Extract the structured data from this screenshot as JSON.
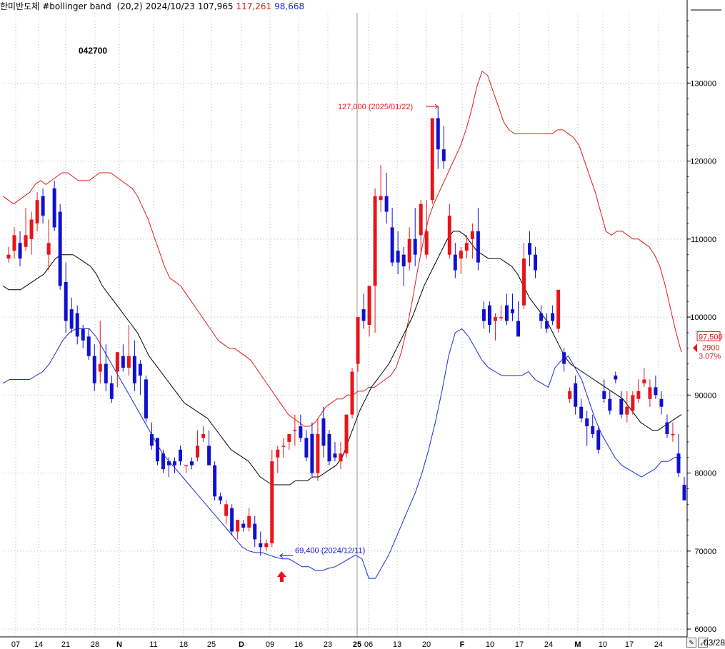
{
  "header": {
    "name": "한미반도체",
    "indicator": "#bollinger band",
    "params": "(20,2)",
    "date": "2024/10/23",
    "middle": "107,965",
    "upper": "117,261",
    "lower": "98,668"
  },
  "code": "042700",
  "colors": {
    "up": "#e8141a",
    "down": "#1010d0",
    "upper_band": "#e01818",
    "lower_band": "#1d2ad8",
    "middle_band": "#000000",
    "grid": "#b8b8b8"
  },
  "end_date": "03/28",
  "toolbar_icons": [
    "pencil-icon",
    "resize-icon"
  ],
  "chart_data": {
    "type": "candlestick",
    "x_ticks": [
      "07",
      "14",
      "21",
      "28",
      "N",
      "11",
      "18",
      "25",
      "D",
      "09",
      "16",
      "23",
      "25",
      "06",
      "13",
      "20",
      "F",
      "10",
      "17",
      "24",
      "M",
      "10",
      "17",
      "24"
    ],
    "ylim": [
      59000,
      139000
    ],
    "y_ticks": [
      60000,
      70000,
      80000,
      90000,
      100000,
      110000,
      120000,
      130000
    ],
    "annotations": [
      {
        "text": "127,000 (2025/01/22)",
        "value": 127000,
        "kind": "high"
      },
      {
        "text": "69,400 (2024/12/11)",
        "value": 69400,
        "kind": "low"
      }
    ],
    "last_price": {
      "price": "97,500",
      "change": "2900",
      "change_pct": "3.07%"
    },
    "series": [
      {
        "name": "candles",
        "values": [
          [
            107500,
            109000,
            107000,
            108000
          ],
          [
            108500,
            111500,
            107500,
            110500
          ],
          [
            109500,
            111000,
            106500,
            107500
          ],
          [
            109000,
            114000,
            108500,
            110500
          ],
          [
            110000,
            113500,
            108000,
            112500
          ],
          [
            112000,
            116000,
            111000,
            115000
          ],
          [
            115500,
            116500,
            112000,
            113000
          ],
          [
            108000,
            112500,
            106000,
            109500
          ],
          [
            116500,
            117500,
            111000,
            111500
          ],
          [
            113500,
            114500,
            103500,
            104000
          ],
          [
            104500,
            107000,
            98000,
            99500
          ],
          [
            101000,
            102500,
            98000,
            98500
          ],
          [
            100500,
            101500,
            96500,
            97500
          ],
          [
            98500,
            99000,
            96000,
            97000
          ],
          [
            97500,
            98500,
            94500,
            95000
          ],
          [
            95000,
            96500,
            90500,
            91500
          ],
          [
            93000,
            99500,
            91500,
            94000
          ],
          [
            94000,
            96500,
            90500,
            91500
          ],
          [
            91500,
            92500,
            89000,
            89500
          ],
          [
            93000,
            95500,
            91000,
            95500
          ],
          [
            95000,
            96500,
            93000,
            93500
          ],
          [
            93500,
            99000,
            92500,
            95000
          ],
          [
            95000,
            97000,
            90500,
            91500
          ],
          [
            94000,
            94500,
            90000,
            92500
          ],
          [
            92000,
            92500,
            86500,
            87000
          ],
          [
            85000,
            86500,
            83000,
            83500
          ],
          [
            84500,
            84500,
            81000,
            81500
          ],
          [
            82500,
            83000,
            80000,
            80500
          ],
          [
            81500,
            82000,
            79500,
            81000
          ],
          [
            81500,
            82000,
            80000,
            81000
          ],
          [
            83000,
            83500,
            81000,
            81500
          ],
          [
            81000,
            81000,
            80000,
            81000
          ],
          [
            81500,
            82000,
            80500,
            81000
          ],
          [
            82000,
            85500,
            81500,
            83500
          ],
          [
            84500,
            86000,
            84000,
            85000
          ],
          [
            83500,
            85500,
            81000,
            81000
          ],
          [
            81000,
            81500,
            76500,
            77000
          ],
          [
            77000,
            77500,
            76000,
            76500
          ],
          [
            74500,
            76500,
            73500,
            76000
          ],
          [
            75500,
            76000,
            72000,
            72500
          ],
          [
            72500,
            74000,
            71500,
            74000
          ],
          [
            73500,
            74000,
            72500,
            73000
          ],
          [
            73000,
            75500,
            72500,
            74500
          ],
          [
            73500,
            74500,
            70500,
            71500
          ],
          [
            71000,
            72500,
            69400,
            70500
          ],
          [
            70500,
            71500,
            70000,
            71000
          ],
          [
            71000,
            83000,
            70500,
            81500
          ],
          [
            82000,
            83500,
            80000,
            83000
          ],
          [
            83500,
            84500,
            82000,
            83500
          ],
          [
            84000,
            85000,
            83000,
            85000
          ],
          [
            85500,
            87500,
            83500,
            85500
          ],
          [
            86000,
            87500,
            84000,
            84500
          ],
          [
            84500,
            85500,
            81500,
            82000
          ],
          [
            85000,
            86500,
            79500,
            80000
          ],
          [
            80000,
            87000,
            79000,
            85000
          ],
          [
            87000,
            88500,
            82000,
            83500
          ],
          [
            85000,
            85500,
            81000,
            81500
          ],
          [
            82500,
            84000,
            81500,
            82000
          ],
          [
            81500,
            84000,
            80500,
            82500
          ],
          [
            82500,
            87500,
            82000,
            87500
          ],
          [
            87500,
            93500,
            87000,
            93000
          ],
          [
            94000,
            99500,
            93000,
            100000
          ],
          [
            101000,
            103000,
            98500,
            99500
          ],
          [
            99000,
            104000,
            97500,
            104000
          ],
          [
            104000,
            116500,
            98000,
            115500
          ],
          [
            115000,
            119500,
            113500,
            115500
          ],
          [
            115500,
            118500,
            112000,
            113500
          ],
          [
            111500,
            114000,
            106500,
            107000
          ],
          [
            108500,
            111000,
            105500,
            107000
          ],
          [
            108000,
            109000,
            104000,
            106500
          ],
          [
            107000,
            111500,
            106000,
            110000
          ],
          [
            110000,
            114000,
            106500,
            108000
          ],
          [
            110500,
            115000,
            108000,
            114500
          ],
          [
            108000,
            115000,
            107500,
            111000
          ],
          [
            115000,
            121500,
            114500,
            125500
          ],
          [
            125500,
            127000,
            119000,
            121500
          ],
          [
            121500,
            124500,
            119000,
            120000
          ],
          [
            108000,
            114500,
            107500,
            113000
          ],
          [
            108000,
            109500,
            105000,
            106000
          ],
          [
            107500,
            109000,
            105500,
            108500
          ],
          [
            108500,
            110500,
            107500,
            109500
          ],
          [
            110000,
            112000,
            107500,
            111000
          ],
          [
            111000,
            114000,
            106000,
            107000
          ],
          [
            101000,
            102000,
            98500,
            99500
          ],
          [
            101500,
            102000,
            98000,
            99000
          ],
          [
            99500,
            100500,
            97000,
            100000
          ],
          [
            100000,
            101500,
            99500,
            100000
          ],
          [
            101500,
            103000,
            99000,
            99500
          ],
          [
            101000,
            103000,
            99500,
            100500
          ],
          [
            99500,
            102000,
            97500,
            97500
          ],
          [
            101500,
            109500,
            101000,
            107500
          ],
          [
            109500,
            111000,
            106500,
            108000
          ],
          [
            108000,
            109000,
            105000,
            106000
          ],
          [
            100500,
            101500,
            98500,
            99500
          ],
          [
            99500,
            100500,
            98000,
            98500
          ],
          [
            100500,
            101500,
            99000,
            99500
          ],
          [
            98500,
            103500,
            98000,
            103500
          ],
          [
            95500,
            96000,
            93000,
            94000
          ],
          [
            89500,
            91000,
            89000,
            90500
          ],
          [
            91500,
            92500,
            87500,
            88500
          ],
          [
            88500,
            89500,
            86500,
            87000
          ],
          [
            87000,
            88000,
            83500,
            86000
          ],
          [
            86000,
            87500,
            84500,
            85000
          ],
          [
            85500,
            86000,
            82500,
            83000
          ],
          [
            90500,
            92000,
            89000,
            89500
          ],
          [
            89500,
            90500,
            87500,
            88000
          ],
          [
            92500,
            93000,
            91500,
            92000
          ],
          [
            89500,
            90500,
            87000,
            87500
          ],
          [
            87500,
            90500,
            86500,
            88500
          ],
          [
            88000,
            90500,
            87500,
            90000
          ],
          [
            89500,
            92000,
            89000,
            90500
          ],
          [
            91500,
            93500,
            91000,
            92000
          ],
          [
            89500,
            92000,
            88500,
            91000
          ],
          [
            91000,
            92500,
            89500,
            90000
          ],
          [
            89500,
            90500,
            87500,
            88500
          ],
          [
            86500,
            87500,
            84500,
            85000
          ],
          [
            85000,
            86500,
            84000,
            85000
          ],
          [
            82500,
            85000,
            79500,
            80000
          ],
          [
            78500,
            79500,
            76500,
            76500
          ]
        ]
      },
      {
        "name": "upper_band",
        "values": [
          115500,
          115000,
          114500,
          115000,
          115500,
          116000,
          117000,
          117500,
          117000,
          117500,
          118000,
          118500,
          118500,
          118000,
          117500,
          117500,
          117500,
          118000,
          118500,
          118500,
          118500,
          118000,
          117500,
          117000,
          116500,
          115500,
          114000,
          112500,
          110500,
          108500,
          106500,
          105000,
          104500,
          104000,
          103000,
          102000,
          101000,
          100000,
          99000,
          98000,
          97000,
          96500,
          96000,
          96000,
          95500,
          95000,
          94500,
          93500,
          92500,
          91500,
          90500,
          89500,
          88500,
          87500,
          87000,
          86500,
          86000,
          86000,
          86500,
          87500,
          88500,
          89000,
          89500,
          89500,
          90000,
          90000,
          90500,
          90500,
          91000,
          91000,
          91500,
          92000,
          92500,
          93500,
          95500,
          98500,
          102000,
          106000,
          109500,
          112500,
          114500,
          116000,
          117500,
          119000,
          120500,
          122000,
          124000,
          126500,
          129500,
          131500,
          131000,
          129000,
          127000,
          125000,
          124000,
          123500,
          123500,
          123500,
          123500,
          123500,
          123500,
          123500,
          123500,
          124000,
          124000,
          123500,
          123000,
          122000,
          120000,
          118000,
          116000,
          113500,
          111000,
          110500,
          111000,
          111000,
          110500,
          110000,
          110000,
          109500,
          109000,
          108000,
          106500,
          104000,
          101000,
          98000,
          95500
        ]
      },
      {
        "name": "middle_band",
        "values": [
          104000,
          103500,
          103500,
          103500,
          104000,
          104500,
          105000,
          105500,
          106500,
          107500,
          108000,
          108000,
          108000,
          107500,
          107000,
          106500,
          105500,
          104000,
          103000,
          102000,
          101000,
          100000,
          99000,
          98000,
          96500,
          95000,
          94000,
          93000,
          92000,
          91000,
          90000,
          89000,
          88500,
          88000,
          87500,
          87000,
          86000,
          85000,
          84000,
          83000,
          82500,
          82000,
          81500,
          80500,
          79500,
          79000,
          78500,
          78500,
          78500,
          78500,
          79000,
          79000,
          79000,
          79500,
          79500,
          80000,
          80500,
          81000,
          82000,
          84000,
          86000,
          88000,
          89500,
          91000,
          92000,
          93000,
          94000,
          95500,
          97000,
          98500,
          100000,
          102000,
          104000,
          105500,
          107000,
          108500,
          110000,
          111000,
          111000,
          110500,
          109500,
          108500,
          108000,
          107500,
          107500,
          107500,
          107000,
          106500,
          105500,
          104000,
          102500,
          101500,
          100500,
          99500,
          98000,
          96500,
          95000,
          94000,
          93500,
          93000,
          92500,
          92000,
          91500,
          91000,
          90500,
          90000,
          89500,
          88500,
          87500,
          86500,
          86000,
          85500,
          85500,
          86000,
          86500,
          87000,
          87500
        ]
      },
      {
        "name": "lower_band",
        "values": [
          91500,
          92000,
          92000,
          92000,
          92000,
          92500,
          93000,
          94000,
          95500,
          97000,
          98000,
          98500,
          98500,
          98500,
          97500,
          96000,
          94500,
          93000,
          91500,
          90000,
          88500,
          87000,
          85500,
          84000,
          82500,
          81500,
          80500,
          79500,
          78500,
          77500,
          76500,
          75500,
          74500,
          73500,
          72500,
          71500,
          70500,
          70000,
          69800,
          69800,
          69500,
          69200,
          69000,
          69000,
          68500,
          68000,
          68000,
          67500,
          67500,
          67800,
          68000,
          68500,
          69000,
          69500,
          69000,
          66500,
          66500,
          68000,
          69500,
          71500,
          73500,
          75500,
          77500,
          80000,
          83000,
          86500,
          90500,
          95000,
          98000,
          98500,
          97500,
          96000,
          94500,
          93500,
          93000,
          92500,
          92500,
          92500,
          92500,
          93000,
          92000,
          91500,
          91000,
          93500,
          94500,
          95000,
          93500,
          92000,
          89500,
          87000,
          85000,
          83500,
          82000,
          81000,
          80500,
          80000,
          79500,
          80000,
          80500,
          81500,
          81500,
          82000,
          82000
        ]
      }
    ]
  }
}
